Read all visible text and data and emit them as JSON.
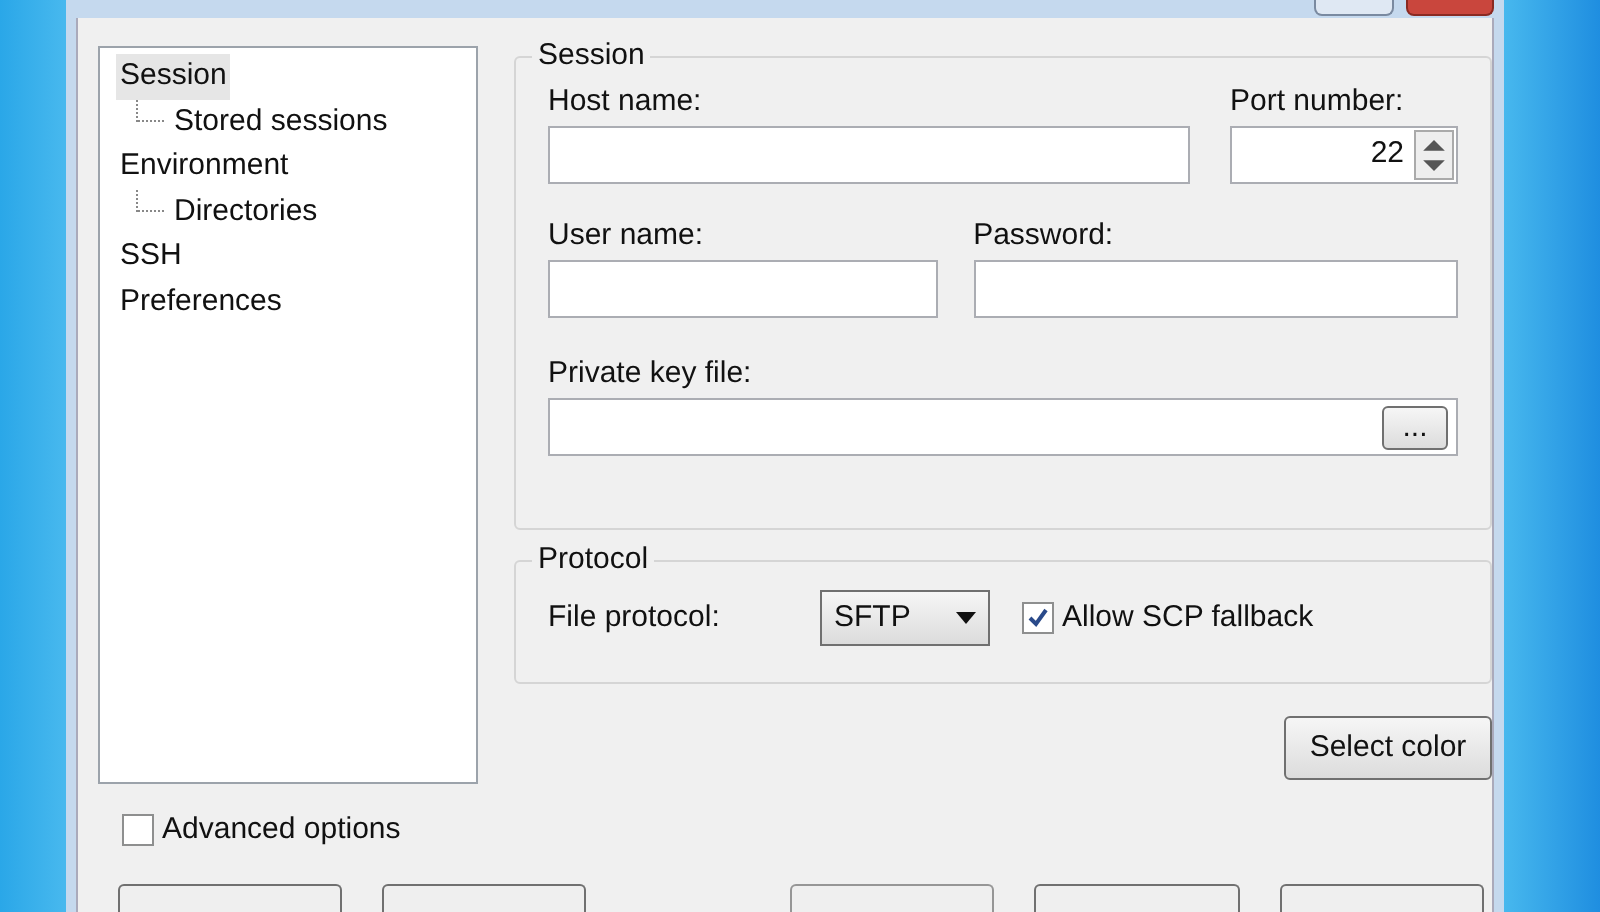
{
  "tree": [
    {
      "label": "Session",
      "selected": true,
      "children": [
        {
          "label": "Stored sessions",
          "selected": false
        }
      ]
    },
    {
      "label": "Environment",
      "selected": false,
      "children": [
        {
          "label": "Directories",
          "selected": false
        }
      ]
    },
    {
      "label": "SSH",
      "selected": false
    },
    {
      "label": "Preferences",
      "selected": false
    }
  ],
  "session": {
    "title": "Session",
    "host_label": "Host name:",
    "port_label": "Port number:",
    "port_value": "22",
    "user_label": "User name:",
    "password_label": "Password:",
    "key_label": "Private key file:",
    "browse_button": "..."
  },
  "protocol": {
    "title": "Protocol",
    "file_protocol_label": "File protocol:",
    "file_protocol_value": "SFTP",
    "scp_fallback": {
      "label": "Allow SCP fallback",
      "checked": true
    }
  },
  "select_color_button": "Select color",
  "advanced_options": {
    "label": "Advanced options",
    "checked": false
  }
}
